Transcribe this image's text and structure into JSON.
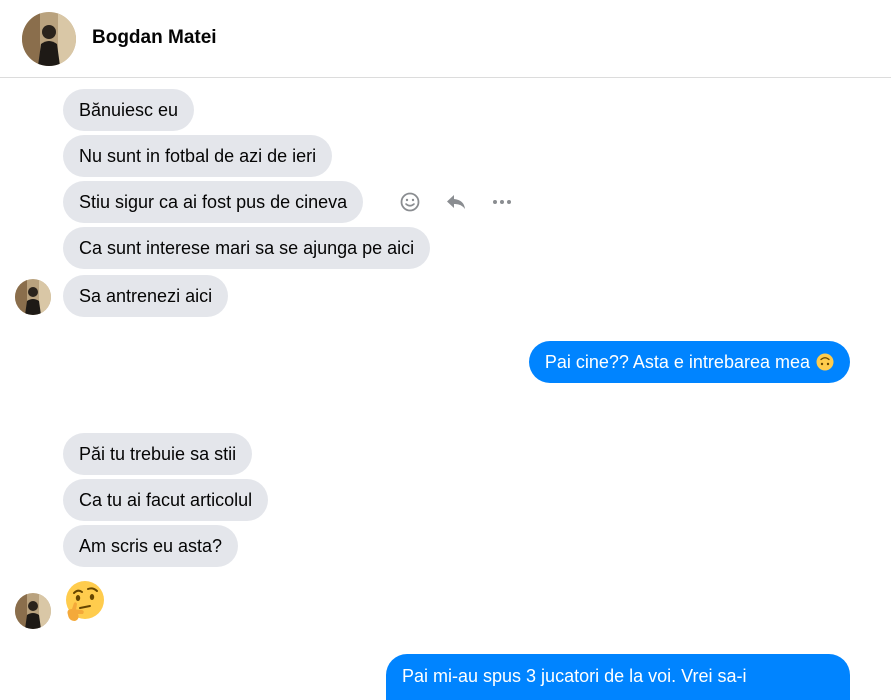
{
  "header": {
    "contact_name": "Bogdan Matei"
  },
  "messages": [
    {
      "side": "in",
      "text": "Bănuiesc eu"
    },
    {
      "side": "in",
      "text": "Nu sunt in fotbal de azi de ieri"
    },
    {
      "side": "in",
      "text": "Stiu sigur ca ai fost pus de cineva"
    },
    {
      "side": "in",
      "text": "Ca sunt interese mari sa se ajunga pe aici"
    },
    {
      "side": "in",
      "text": "Sa antrenezi aici"
    },
    {
      "side": "out",
      "text": "Pai cine?? Asta e intrebarea mea",
      "emoji": "upside-down-face-emoji"
    },
    {
      "side": "in",
      "text": "Păi tu trebuie sa stii"
    },
    {
      "side": "in",
      "text": "Ca tu ai facut articolul"
    },
    {
      "side": "in",
      "text": "Am scris eu asta?"
    },
    {
      "side": "in",
      "emoji": "thinking-face-emoji"
    },
    {
      "side": "out",
      "text": "Pai mi-au spus 3 jucatori de la voi. Vrei sa-i"
    }
  ],
  "hover_actions": {
    "icons": [
      "react-smiley-icon",
      "reply-icon",
      "more-options-icon"
    ]
  },
  "colors": {
    "incoming_bubble": "#e4e6eb",
    "outgoing_bubble": "#0084ff",
    "header_border": "#dcdcdc"
  }
}
